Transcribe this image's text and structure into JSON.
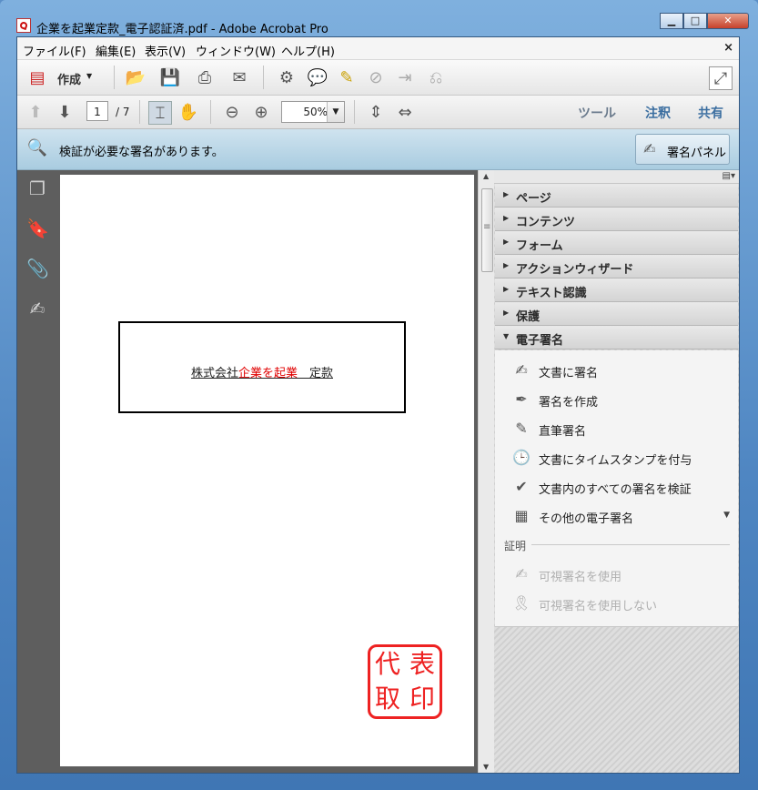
{
  "window": {
    "title": "企業を起業定款_電子認証済.pdf - Adobe Acrobat Pro",
    "minimize_label": "▁",
    "maximize_label": "□",
    "close_label": "✕"
  },
  "menubar": {
    "items": [
      "ファイル(F)",
      "編集(E)",
      "表示(V)",
      "ウィンドウ(W)",
      "ヘルプ(H)"
    ],
    "close_label": "×"
  },
  "toolbar": {
    "create_label": "作成",
    "icons": [
      "create-pdf-icon",
      "open-folder-icon",
      "save-icon",
      "print-icon",
      "email-icon",
      "settings-icon",
      "comment-icon",
      "highlight-icon",
      "delete-page-icon",
      "export-icon",
      "sign-icon",
      "expand-icon"
    ]
  },
  "navbar": {
    "current_page": "1",
    "total_pages": "/ 7",
    "zoom": "50%",
    "tools_link": "ツール",
    "comment_link": "注釈",
    "share_link": "共有"
  },
  "signature_bar": {
    "message": "検証が必要な署名があります。",
    "panel_button": "署名パネル"
  },
  "document": {
    "title_prefix": "株式会社",
    "title_highlight": "企業を起業",
    "title_suffix": "　定款",
    "seal_chars": [
      "代",
      "表",
      "取",
      "印"
    ]
  },
  "right_panel": {
    "sections": [
      "ページ",
      "コンテンツ",
      "フォーム",
      "アクションウィザード",
      "テキスト認識",
      "保護",
      "電子署名"
    ],
    "sign_items": [
      "文書に署名",
      "署名を作成",
      "直筆署名",
      "文書にタイムスタンプを付与",
      "文書内のすべての署名を検証",
      "その他の電子署名"
    ],
    "cert_label": "証明",
    "cert_items": [
      "可視署名を使用",
      "可視署名を使用しない"
    ]
  },
  "colors": {
    "accent_red": "#e00000",
    "seal_red": "#e22222",
    "sigbar_blue": "#a9cce0"
  }
}
